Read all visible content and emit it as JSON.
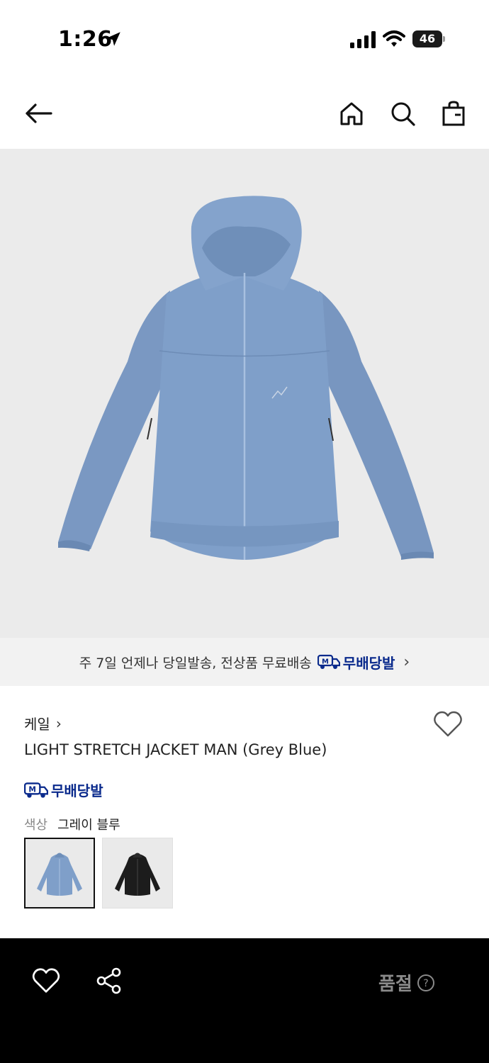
{
  "status_bar": {
    "time": "1:26",
    "battery": "46"
  },
  "promo_banner": {
    "text": "주 7일 언제나 당일발송, 전상품 무료배송",
    "badge_label": "무배당발"
  },
  "product": {
    "brand": "케일",
    "name": "LIGHT STRETCH JACKET MAN (Grey Blue)",
    "delivery_badge": "무배당발",
    "color_label": "색상",
    "color_value": "그레이 블루",
    "swatches": [
      {
        "name": "grey-blue",
        "color": "#7f9fc9",
        "selected": true
      },
      {
        "name": "black",
        "color": "#1c1c1c",
        "selected": false
      }
    ]
  },
  "bottom_bar": {
    "status_label": "품절"
  },
  "colors": {
    "background": "#ffffff",
    "image_bg": "#ebebeb",
    "banner_bg": "#f2f2f2",
    "bottom_bar": "#000000",
    "badge_blue": "#0a2a8c",
    "jacket": "#7f9fc9"
  },
  "icons": [
    "location-arrow-icon",
    "signal-icon",
    "wifi-icon",
    "battery-icon",
    "back-arrow-icon",
    "home-icon",
    "search-icon",
    "shopping-bag-icon",
    "heart-icon",
    "share-icon",
    "help-icon",
    "chevron-right-icon",
    "delivery-truck-icon"
  ]
}
